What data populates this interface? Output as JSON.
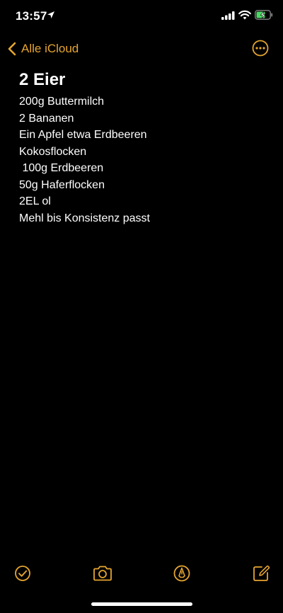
{
  "status_bar": {
    "time": "13:57",
    "icons": [
      "location-icon",
      "signal-icon",
      "wifi-icon",
      "battery-charging-icon"
    ]
  },
  "nav": {
    "back_label": "Alle iCloud",
    "back_icon": "chevron-left-icon",
    "more_icon": "ellipsis-circle-icon"
  },
  "note": {
    "title": "2 Eier",
    "lines": [
      "200g Buttermilch",
      "2 Bananen",
      "Ein Apfel etwa Erdbeeren",
      "Kokosflocken",
      " 100g Erdbeeren",
      "50g Haferflocken",
      "2EL ol",
      "Mehl bis Konsistenz passt"
    ]
  },
  "toolbar": {
    "icons": [
      "checklist-icon",
      "camera-icon",
      "markup-pen-icon",
      "compose-icon"
    ]
  },
  "colors": {
    "accent": "#e5a530",
    "background": "#000000",
    "text": "#ffffff",
    "battery_charging": "#4cd964"
  }
}
